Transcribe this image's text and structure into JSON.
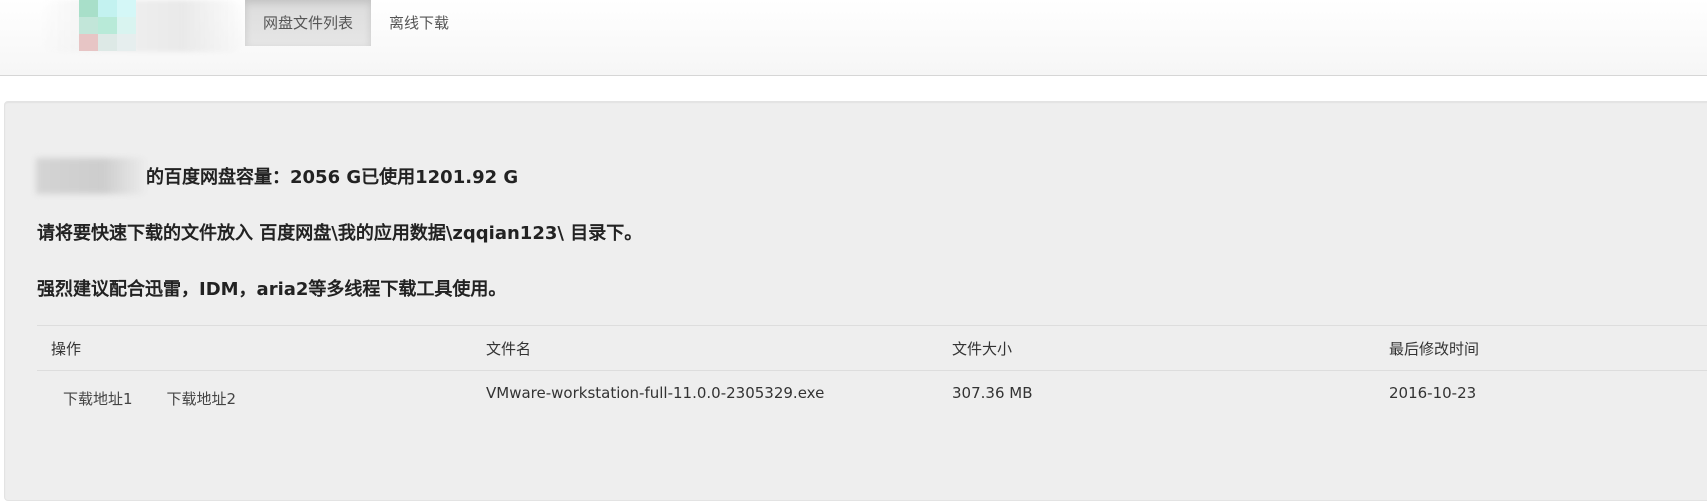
{
  "nav": {
    "tabs": [
      {
        "label": "网盘文件列表",
        "active": true
      },
      {
        "label": "离线下载",
        "active": false
      }
    ]
  },
  "info": {
    "capacity": "的百度网盘容量：2056 G已使用1201.92 G",
    "instruction": "请将要快速下载的文件放入 百度网盘\\我的应用数据\\zqqian123\\ 目录下。",
    "recommendation": "强烈建议配合迅雷，IDM，aria2等多线程下载工具使用。"
  },
  "table": {
    "headers": [
      "操作",
      "文件名",
      "文件大小",
      "最后修改时间"
    ],
    "rows": [
      {
        "links": [
          "下载地址1",
          "下载地址2"
        ],
        "filename": "VMware-workstation-full-11.0.0-2305329.exe",
        "size": "307.36 MB",
        "modified": "2016-10-23"
      }
    ]
  },
  "colors": {
    "panel_bg": "#eeeeee",
    "active_tab_bg": "#dcdcdc",
    "text": "#333333"
  }
}
